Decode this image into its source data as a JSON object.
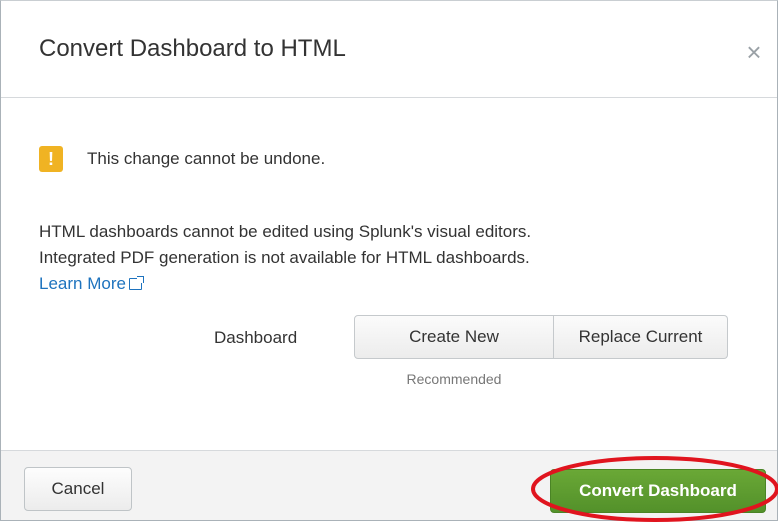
{
  "dialog": {
    "title": "Convert Dashboard to HTML",
    "close_glyph": "×",
    "warning": {
      "icon": "!",
      "icon_name": "warning-icon",
      "icon_color": "#f0b323",
      "text": "This change cannot be undone."
    },
    "description_line1": "HTML dashboards cannot be edited using Splunk's visual editors.",
    "description_line2": "Integrated PDF generation is not available for HTML dashboards.",
    "learn_more": "Learn More",
    "dashboard_label": "Dashboard",
    "options": {
      "create_new": "Create New",
      "replace_current": "Replace Current"
    },
    "recommended": "Recommended"
  },
  "footer": {
    "cancel_label": "Cancel",
    "convert_label": "Convert Dashboard",
    "convert_color": "#5c9b2f",
    "highlight_color": "#e0141e"
  }
}
